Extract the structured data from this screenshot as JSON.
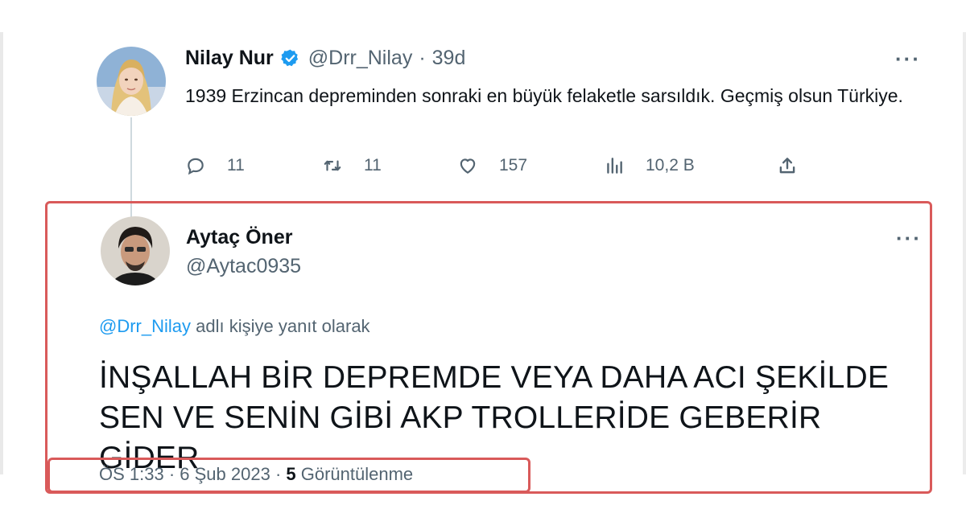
{
  "original_tweet": {
    "display_name": "Nilay Nur",
    "handle": "@Drr_Nilay",
    "separator": "·",
    "time_ago": "39d",
    "more": "···",
    "text": "1939 Erzincan depreminden sonraki en büyük felaketle sarsıldık. Geçmiş olsun Türkiye.",
    "actions": {
      "replies": "11",
      "retweets": "11",
      "likes": "157",
      "views": "10,2 B"
    },
    "icons": {
      "verified": "verified-badge-icon",
      "reply": "reply-icon",
      "retweet": "retweet-icon",
      "like": "heart-icon",
      "views": "views-chart-icon",
      "share": "share-icon"
    }
  },
  "reply_tweet": {
    "display_name": "Aytaç Öner",
    "handle": "@Aytac0935",
    "more": "···",
    "reply_context_mention": "@Drr_Nilay",
    "reply_context_text": " adlı kişiye yanıt olarak",
    "text_line_1": "İNŞALLAH BİR DEPREMDE VEYA DAHA ACI ŞEKİLDE",
    "text_line_2": "SEN VE SENİN GİBİ AKP TROLLERİDE GEBERİR GİDER",
    "meta_time": "ÖS 1:33",
    "meta_date": "6 Şub 2023",
    "meta_separator": " · ",
    "views_count": "5",
    "views_label": " Görüntülenme"
  },
  "colors": {
    "text_primary": "#0f1419",
    "text_secondary": "#536471",
    "link_blue": "#1d9bf0",
    "highlight_red": "#d95a5a"
  }
}
